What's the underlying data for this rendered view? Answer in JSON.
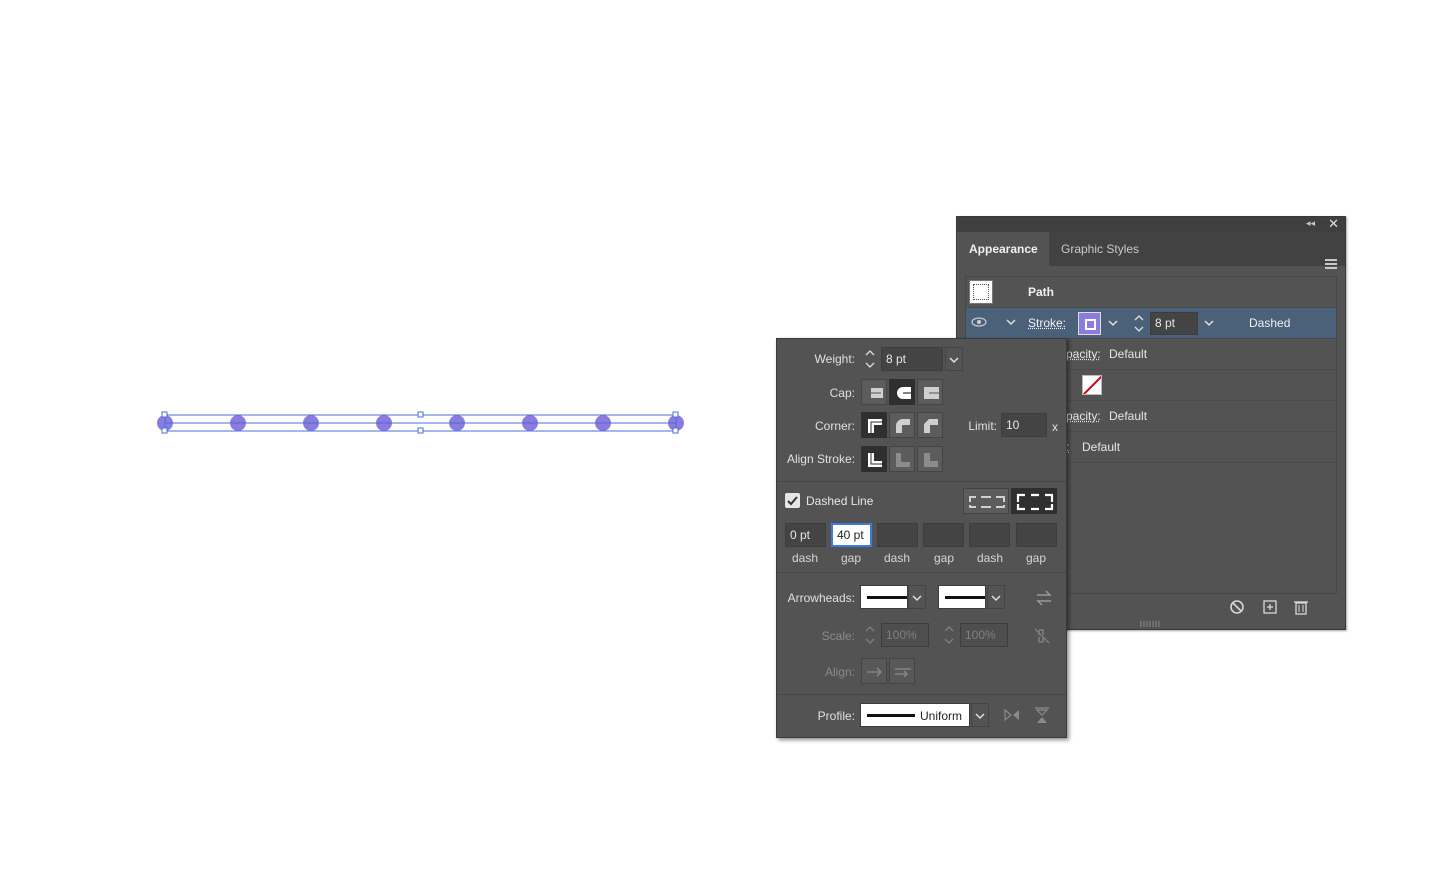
{
  "appearance_panel": {
    "tabs": [
      "Appearance",
      "Graphic Styles"
    ],
    "object_type": "Path",
    "stroke": {
      "label": "Stroke:",
      "color": "#8a7be0",
      "weight": "8 pt",
      "style": "Dashed"
    },
    "rows": [
      {
        "label": "pacity:",
        "value": "Default"
      },
      {
        "label": "pacity:",
        "value": "Default"
      },
      {
        "label": ":",
        "value": "Default"
      }
    ]
  },
  "stroke_panel": {
    "weight_label": "Weight:",
    "weight_value": "8 pt",
    "cap_label": "Cap:",
    "corner_label": "Corner:",
    "limit_label": "Limit:",
    "limit_value": "10",
    "limit_unit": "x",
    "align_label": "Align Stroke:",
    "dashed_label": "Dashed Line",
    "dashed_checked": true,
    "dash_values": [
      "0 pt",
      "40 pt",
      "",
      "",
      "",
      ""
    ],
    "dash_labels": [
      "dash",
      "gap",
      "dash",
      "gap",
      "dash",
      "gap"
    ],
    "arrowheads_label": "Arrowheads:",
    "scale_label": "Scale:",
    "scale_start": "100%",
    "scale_end": "100%",
    "align_arrow_label": "Align:",
    "profile_label": "Profile:",
    "profile_value": "Uniform"
  },
  "artwork": {
    "dot_color": "#8a7be0",
    "dot_count": 8
  }
}
